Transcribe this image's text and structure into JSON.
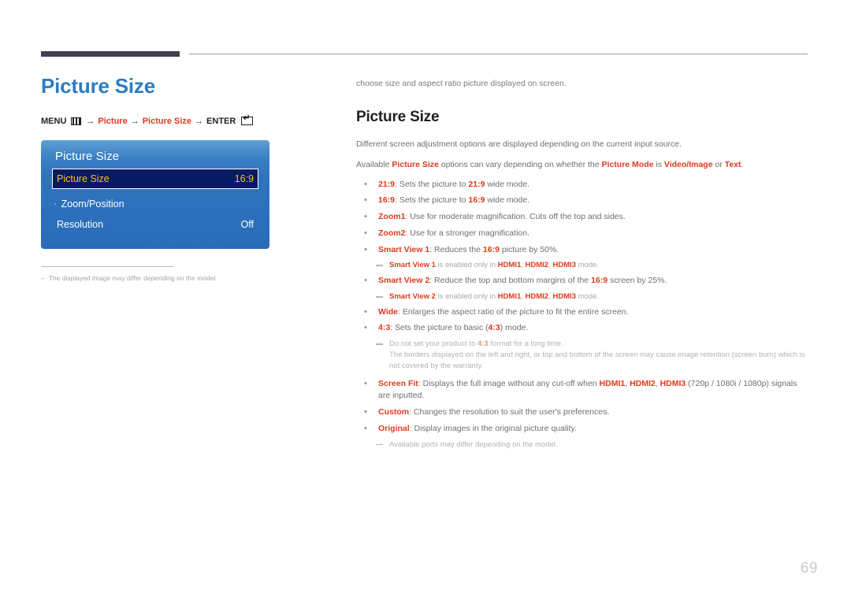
{
  "header": {
    "rule_color": "#443d54"
  },
  "left": {
    "page_title": "Picture Size",
    "menu_path": {
      "menu_label": "MENU",
      "menu_icon": "menu-grid-icon",
      "arrow": "→",
      "item1": "Picture",
      "item2": "Picture Size",
      "enter_label": "ENTER",
      "enter_icon": "enter-key-icon"
    },
    "osd": {
      "title": "Picture Size",
      "rows": [
        {
          "label": "Picture Size",
          "value": "16:9",
          "selected": true
        },
        {
          "label": "Zoom/Position",
          "value": "",
          "selected": false,
          "submenu": true
        },
        {
          "label": "Resolution",
          "value": "Off",
          "selected": false
        }
      ]
    },
    "footnote": {
      "dash": "–",
      "text": "The displayed image may differ depending on the model."
    }
  },
  "right": {
    "intro": "choose size and aspect ratio picture displayed on screen.",
    "section_title": "Picture Size",
    "para1": "Different screen adjustment options are displayed depending on the current input source.",
    "para2_a": "Available ",
    "para2_b": "Picture Size",
    "para2_c": " options can vary depending on whether the ",
    "para2_d": "Picture Mode",
    "para2_e": " is ",
    "para2_f": "Video/Image",
    "para2_g": " or ",
    "para2_h": "Text",
    "para2_i": ".",
    "bullets": [
      {
        "term": "21:9",
        "rest_a": ": Sets the picture to ",
        "em": "21:9",
        "rest_b": " wide mode."
      },
      {
        "term": "16:9",
        "rest_a": ": Sets the picture to ",
        "em": "16:9",
        "rest_b": " wide mode."
      },
      {
        "term": "Zoom1",
        "rest_a": ": Use for moderate magnification. Cuts off the top and sides.",
        "em": "",
        "rest_b": ""
      },
      {
        "term": "Zoom2",
        "rest_a": ": Use for a stronger magnification.",
        "em": "",
        "rest_b": ""
      },
      {
        "term": "Smart View 1",
        "rest_a": ": Reduces the ",
        "em": "16:9",
        "rest_b": " picture by 50%."
      }
    ],
    "note_sv1": {
      "term": "Smart View 1",
      "mid": " is enabled only in ",
      "h1": "HDMI1",
      "sep1": ", ",
      "h2": "HDMI2",
      "sep2": ", ",
      "h3": "HDMI3",
      "tail": " mode."
    },
    "bullet_sv2": {
      "term": "Smart View 2",
      "rest_a": ": Reduce the top and bottom margins of the ",
      "em": "16:9",
      "rest_b": " screen by 25%."
    },
    "note_sv2": {
      "term": "Smart View 2",
      "mid": " is enabled only in ",
      "h1": "HDMI1",
      "sep1": ", ",
      "h2": "HDMI2",
      "sep2": ", ",
      "h3": "HDMI3",
      "tail": " mode."
    },
    "bullet_wide": {
      "term": "Wide",
      "rest_a": ": Enlarges the aspect ratio of the picture to fit the entire screen."
    },
    "bullet_43": {
      "term": "4:3",
      "rest_a": ": Sets the picture to basic (",
      "em": "4:3",
      "rest_b": ") mode."
    },
    "note_43": {
      "lead_a": "Do not set your product to ",
      "em": "4:3",
      "lead_b": " format for a long time.",
      "body": "The borders displayed on the left and right, or top and bottom of the screen may cause image retention (screen burn) which is not covered by the warranty."
    },
    "bullet_screenfit": {
      "term": "Screen Fit",
      "rest_a": ": Displays the full image without any cut-off when ",
      "h1": "HDMI1",
      "sep1": ", ",
      "h2": "HDMI2",
      "sep2": ", ",
      "h3": "HDMI3",
      "rest_b": " (720p / 1080i / 1080p) signals are inputted."
    },
    "bullet_custom": {
      "term": "Custom",
      "rest_a": ": Changes the resolution to suit the user's preferences."
    },
    "bullet_original": {
      "term": "Original",
      "rest_a": ": Display images in the original picture quality."
    },
    "note_ports": {
      "text": "Available ports may differ depending on the model."
    }
  },
  "page_number": "69"
}
